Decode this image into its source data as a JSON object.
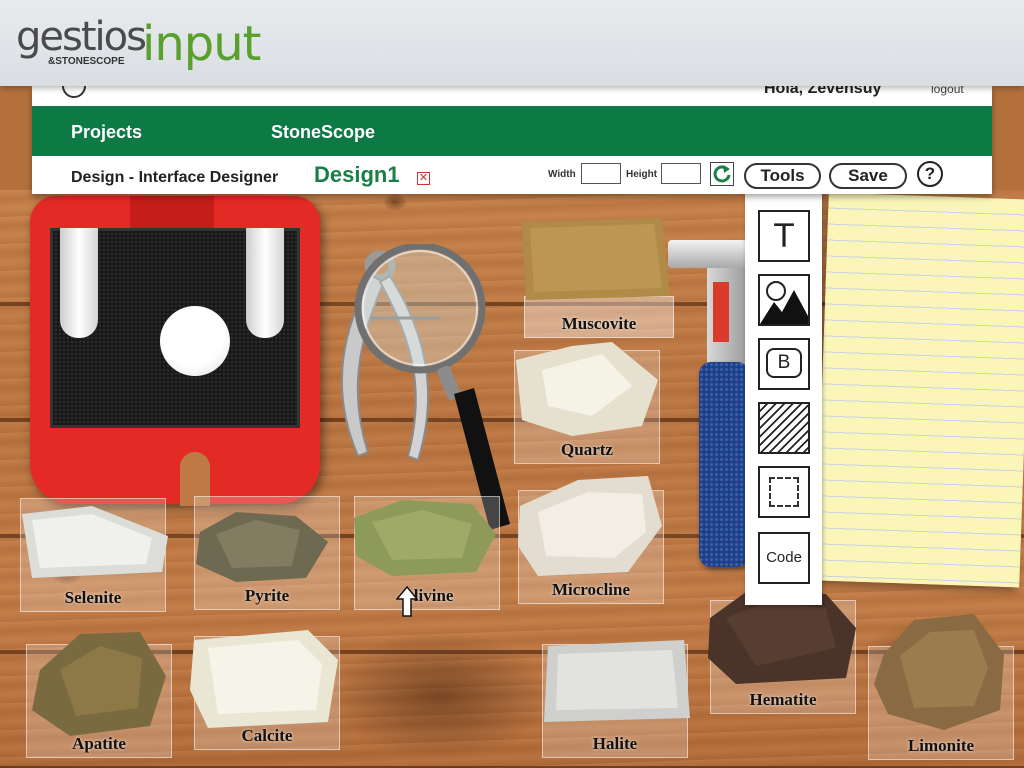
{
  "banner": {
    "logo_main": "gestios",
    "logo_amp": "&",
    "logo_sub": "STONESCOPE",
    "logo_product": "input"
  },
  "app": {
    "greeting": "Hola, Zevensuy",
    "logout": "logout",
    "nav": [
      "Projects",
      "StoneScope"
    ],
    "designer_label": "Design - Interface Designer",
    "design_name": "Design1",
    "close_symbol": "✕",
    "width_label": "Width",
    "height_label": "Height",
    "width_value": "",
    "height_value": "",
    "tools_label": "Tools",
    "save_label": "Save",
    "help_label": "?"
  },
  "tools": [
    {
      "name": "text-tool",
      "glyph": "T"
    },
    {
      "name": "image-tool",
      "glyph": ""
    },
    {
      "name": "button-tool",
      "glyph": "B"
    },
    {
      "name": "pattern-tool",
      "glyph": ""
    },
    {
      "name": "region-tool",
      "glyph": ""
    },
    {
      "name": "code-tool",
      "glyph": "Code"
    }
  ],
  "specimens": [
    {
      "label": "Muscovite"
    },
    {
      "label": "Quartz"
    },
    {
      "label": "Selenite"
    },
    {
      "label": "Pyrite"
    },
    {
      "label": "Olivine"
    },
    {
      "label": "Microcline"
    },
    {
      "label": "Apatite"
    },
    {
      "label": "Calcite"
    },
    {
      "label": "Halite"
    },
    {
      "label": "Hematite"
    },
    {
      "label": "Limonite"
    }
  ],
  "colors": {
    "nav_green": "#0d7a45",
    "design_green": "#1a7f46",
    "logo_green": "#5aa02c",
    "toolbox_red": "#e32a25"
  }
}
